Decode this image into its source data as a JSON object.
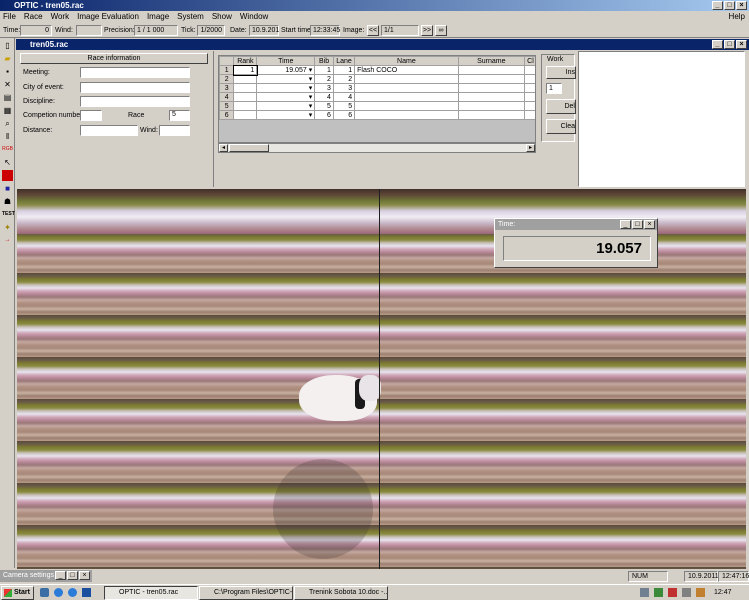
{
  "window": {
    "title": "OPTIC - tren05.rac"
  },
  "menu": [
    "File",
    "Race",
    "Work",
    "Image Evaluation",
    "Image",
    "System",
    "Show",
    "Window"
  ],
  "menu_help": "Help",
  "toolbar": {
    "time_label": "Time:",
    "time_value": "0",
    "wind_label": "Wind:",
    "wind_value": "",
    "precision_label": "Precision:",
    "precision_value": "1 / 1 000",
    "tick_label": "Tick:",
    "tick_value": "1/2000",
    "date_label": "Date:",
    "date_value": "10.9.201",
    "start_label": "Start time",
    "start_value": "12:33:45",
    "image_label": "Image:",
    "image_value": "1/1",
    "prev": "<<",
    "next": ">>"
  },
  "doc": {
    "title": "tren05.rac"
  },
  "race_info": {
    "header": "Race information",
    "meeting_label": "Meeting:",
    "meeting_value": "",
    "city_label": "City of event:",
    "city_value": "",
    "discipline_label": "Discipline:",
    "discipline_value": "",
    "competition_label": "Competion number:",
    "competition_value": "",
    "race_label": "Race",
    "race_value": "5",
    "distance_label": "Distance:",
    "distance_value": "",
    "wind_label": "Wind:",
    "wind_value": ""
  },
  "table": {
    "headers": [
      "",
      "Rank",
      "Time",
      "Bib",
      "Lane",
      "Name",
      "Surname",
      "Cl"
    ],
    "rows": [
      [
        "1",
        "1",
        "19.057",
        "1",
        "1",
        "Flash COCO",
        "",
        ""
      ],
      [
        "2",
        "",
        "",
        "2",
        "2",
        "",
        "",
        ""
      ],
      [
        "3",
        "",
        "",
        "3",
        "3",
        "",
        "",
        ""
      ],
      [
        "4",
        "",
        "",
        "4",
        "4",
        "",
        "",
        ""
      ],
      [
        "5",
        "",
        "",
        "5",
        "5",
        "",
        "",
        ""
      ],
      [
        "6",
        "",
        "",
        "6",
        "6",
        "",
        "",
        ""
      ]
    ]
  },
  "work": {
    "header": "Work",
    "insert": "Ins",
    "spin": "1",
    "delete": "Del",
    "clear": "Clea"
  },
  "time_popup": {
    "title": "Time:",
    "value": "19.057"
  },
  "camera": {
    "title": "Camera settings"
  },
  "status": {
    "num": "NUM",
    "date": "10.9.2011",
    "time": "12:47:16"
  },
  "taskbar": {
    "start": "Start",
    "items": [
      "OPTIC - tren05.rac",
      "C:\\Program Files\\OPTIC-...",
      "Trenink Sobota 10.doc -..."
    ],
    "clock": "12:47"
  },
  "colors": {
    "title_active": "#0a246a",
    "face": "#d4d0c8"
  }
}
